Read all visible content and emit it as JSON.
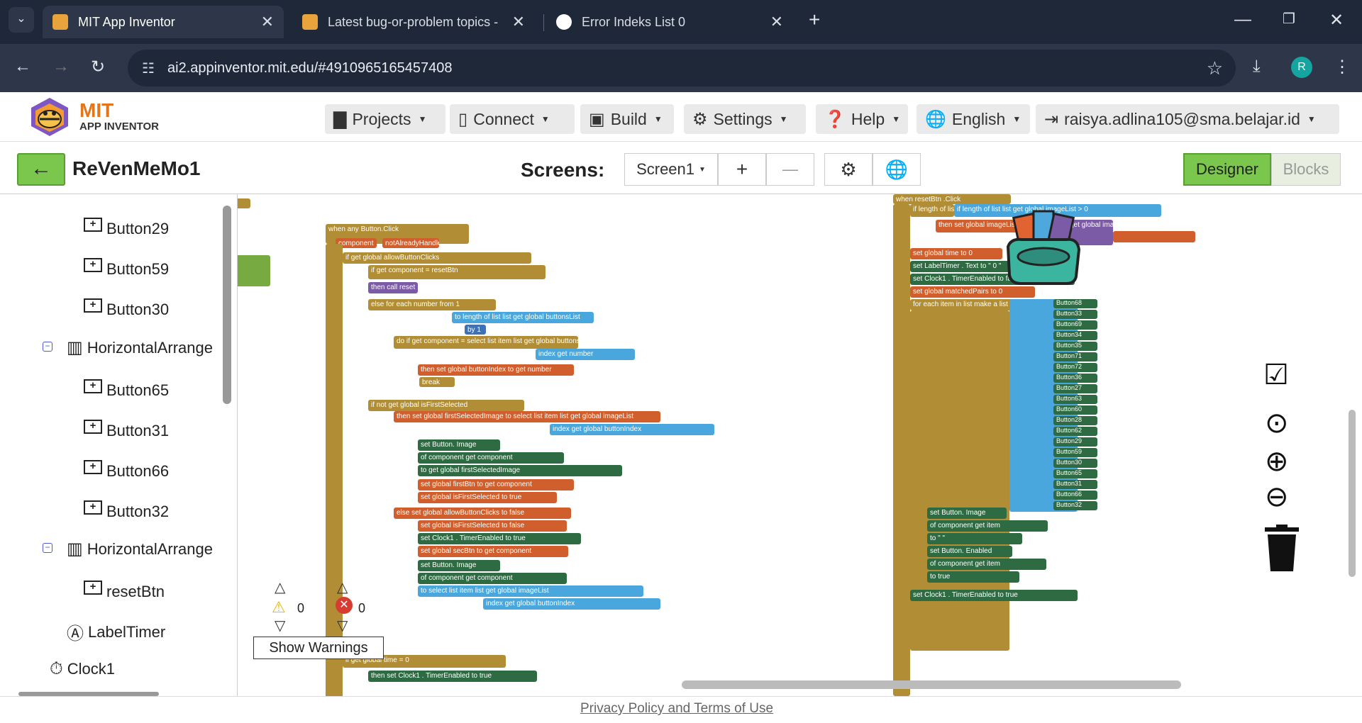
{
  "browser": {
    "tabs": [
      {
        "title": "MIT App Inventor",
        "active": true
      },
      {
        "title": "Latest bug-or-problem topics -",
        "active": false
      },
      {
        "title": "Error Indeks List 0",
        "active": false
      }
    ],
    "new_tab": "+",
    "url": "ai2.appinventor.mit.edu/#4910965165457408",
    "profile_initial": "R"
  },
  "app": {
    "logo_mit": "MIT",
    "logo_sub": "APP INVENTOR",
    "menus": [
      {
        "label": "Projects",
        "icon": "folder-icon"
      },
      {
        "label": "Connect",
        "icon": "phone-icon"
      },
      {
        "label": "Build",
        "icon": "build-icon"
      },
      {
        "label": "Settings",
        "icon": "gear-icon"
      },
      {
        "label": "Help",
        "icon": "help-icon"
      },
      {
        "label": "English",
        "icon": "globe-icon"
      },
      {
        "label": "raisya.adlina105@sma.belajar.id",
        "icon": "logout-icon"
      }
    ]
  },
  "project": {
    "name": "ReVenMeMo1",
    "screens_label": "Screens:",
    "screen_select": "Screen1",
    "add": "+",
    "remove": "—",
    "designer": "Designer",
    "blocks": "Blocks"
  },
  "tree": {
    "items": [
      {
        "label": "Button29",
        "type": "button"
      },
      {
        "label": "Button59",
        "type": "button"
      },
      {
        "label": "Button30",
        "type": "button"
      },
      {
        "label": "HorizontalArrange",
        "type": "arrangement"
      },
      {
        "label": "Button65",
        "type": "button"
      },
      {
        "label": "Button31",
        "type": "button"
      },
      {
        "label": "Button66",
        "type": "button"
      },
      {
        "label": "Button32",
        "type": "button"
      },
      {
        "label": "HorizontalArrange",
        "type": "arrangement"
      },
      {
        "label": "resetBtn",
        "type": "button"
      },
      {
        "label": "LabelTimer",
        "type": "label"
      },
      {
        "label": "Clock1",
        "type": "clock"
      }
    ]
  },
  "workspace": {
    "warnings_count": "0",
    "errors_count": "0",
    "show_warnings": "Show Warnings",
    "left_block": {
      "header": "when any Button.Click",
      "params": [
        "component",
        "notAlreadyHandled"
      ],
      "lines": [
        "if  get global allowButtonClicks",
        "if  get component  =  resetBtn",
        "then  call reset",
        "else  for each number from 1",
        "to  length of list list  get global buttonsList",
        "by 1",
        "do  if  get component  =  select list item list  get global buttonsList",
        "index  get number",
        "then  set global buttonIndex to  get number",
        "break",
        "if  not  get global isFirstSelected",
        "then  set global firstSelectedImage to  select list item list  get global imageList",
        "index  get global buttonIndex",
        "set Button. Image",
        "of component  get component",
        "to  get global firstSelectedImage",
        "set global firstBtn to  get component",
        "set global isFirstSelected to  true",
        "else  set global allowButtonClicks to  false",
        "set global isFirstSelected to  false",
        "set Clock1 . TimerEnabled to  true",
        "set global secBtn to  get component",
        "set Button. Image",
        "of component  get component",
        "to  select list item list  get global imageList",
        "index  get global buttonIndex",
        "if  get global time  =  0",
        "then  set Clock1 . TimerEnabled to  true"
      ]
    },
    "right_block": {
      "header": "when resetBtn .Click",
      "lines": [
        "if  length of list list  get global imageList  >  0",
        "then  set global imageList to  call shuffle",
        "list  get global imageList",
        "set global time to 0",
        "set LabelTimer . Text to  \" 0 \"",
        "set Clock1 . TimerEnabled to  false",
        "set global matchedPairs to 0",
        "for each item in list  make a list"
      ],
      "list_items": [
        "Button68",
        "Button33",
        "Button69",
        "Button34",
        "Button35",
        "Button71",
        "Button72",
        "Button36",
        "Button27",
        "Button63",
        "Button60",
        "Button28",
        "Button62",
        "Button29",
        "Button59",
        "Button30",
        "Button65",
        "Button31",
        "Button66",
        "Button32"
      ],
      "do_lines": [
        "set Button. Image",
        "of component  get item",
        "to  \"  \"",
        "set Button. Enabled",
        "of component  get item",
        "to  true",
        "set Clock1 . TimerEnabled to  true"
      ]
    }
  },
  "footer": {
    "privacy": "Privacy Policy and Terms of Use"
  }
}
